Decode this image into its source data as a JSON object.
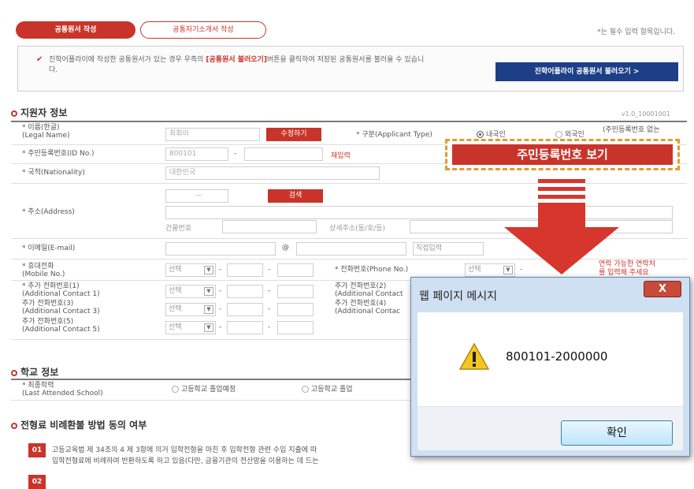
{
  "tabs": {
    "active": "공통원서 작성",
    "inactive": "공통자기소개서 작성"
  },
  "required_note": "*는 필수 입력 항목입니다.",
  "notice": {
    "check": "✔",
    "text_before": "진학어플라이에 작성한 공통원서가 있는 경우 우측의 ",
    "highlight": "[공통원서 불러오기]",
    "text_after": "버튼을 클릭하여 저장된 공통원서를 불러올 수 있습니다.",
    "button": "진학어플라이 공통원서 불러오기 >"
  },
  "applicant_section": {
    "title": "지원자 정보",
    "version": "v1.0_10001001",
    "fields": {
      "legal_name_label": "* 이름(한글)",
      "legal_name_sub": "(Legal Name)",
      "legal_name_value": "최회이",
      "edit_button": "수정하기",
      "type_label": "* 구분(Applicant Type)",
      "type_domestic": "내국인",
      "type_foreign": "외국인",
      "type_note": "(주민등록번호 없는",
      "id_label": "* 주민등록번호(ID No.)",
      "id_value": "800101",
      "id_dash": "-",
      "reenter_link": "재입력",
      "nationality_label": "* 국적(Nationality)",
      "nationality_value": "대한민국",
      "address_label": "* 주소(Address)",
      "zip_dash": "—",
      "search_button": "검색",
      "building_no": "건물번호",
      "detail_address": "상세주소(동/호/등)",
      "email_label": "* 이메일(E-mail)",
      "email_at": "@",
      "direct_input": "직접입력",
      "mobile_label": "* 휴대전화",
      "mobile_sub": "(Mobile No.)",
      "select_text": "선택",
      "phone_label": "* 전화번호(Phone No.)",
      "phone_note_1": "연락 가능한 연락처",
      "phone_note_2": "를 입력해 주세요",
      "contact1_label": "* 추가 전화번호(1)",
      "contact1_sub": "(Additional Contact 1)",
      "contact2_label": "추가 전화번호(2)",
      "contact2_sub": "(Additional Contact",
      "contact3_label": "추가 전화번호(3)",
      "contact3_sub": "(Additional Contact 3)",
      "contact4_label": "추가 전화번호(4)",
      "contact4_sub": "(Additional Contac",
      "contact5_label": "추가 전화번호(5)",
      "contact5_sub": "(Additional Contact 5)"
    }
  },
  "reveal_banner": "주민등록번호 보기",
  "school_section": {
    "title": "학교 정보",
    "last_school_label": "* 최종학력",
    "last_school_sub": "(Last Attended School)",
    "option_expected": "고등학교 졸업예정",
    "option_graduated": "고등학교 졸업"
  },
  "refund_section": {
    "title": "전형료 비례환불 방법 동의 여부",
    "item1_num": "01",
    "item1_line1": "고등교육법 제 34조의 4 제 3항에 의거 입학전형을 마친 후 입학전형 관련 수입 지출에 따",
    "item1_line2": "입학전형료에 비례하여 반환하도록 하고 있음(다만, 금융기관의 전산망을 이용하는 데 드는",
    "item2_num": "02"
  },
  "dialog": {
    "title": "웹 페이지 메시지",
    "close": "X",
    "message": "800101-2000000",
    "ok_button": "확인"
  },
  "colors": {
    "accent_red": "#c9342a",
    "navy": "#1d3f87",
    "banner_border": "#e69a2e"
  }
}
